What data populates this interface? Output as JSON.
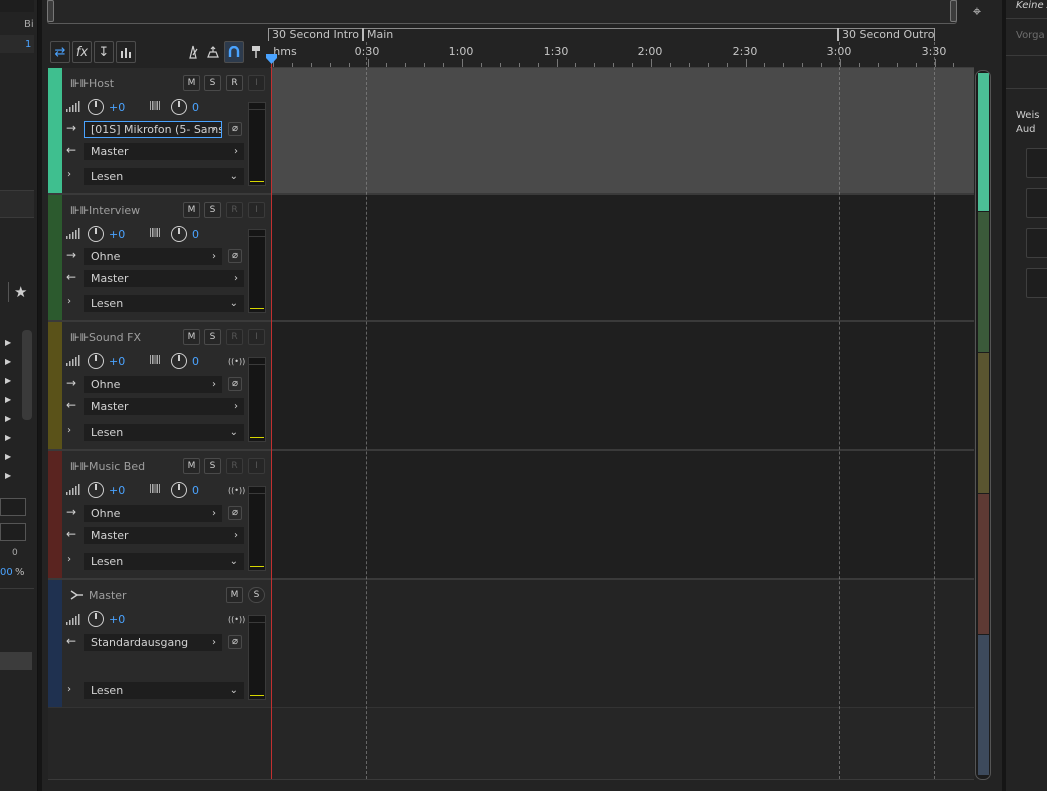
{
  "left_panel": {
    "bit_label": "Bi",
    "blue_value": "1",
    "zero_value": "0",
    "percent_value": "00",
    "percent_unit": "%"
  },
  "toolbar": {
    "buttons": [
      "toggle-inputs",
      "fx",
      "send",
      "eq",
      "metronome",
      "record-monitor",
      "snap",
      "marker"
    ]
  },
  "markers": [
    {
      "label": "30 Second Intro"
    },
    {
      "label": "Main"
    },
    {
      "label": "30 Second Outro"
    }
  ],
  "ruler": {
    "unit_label": "hms",
    "ticks": [
      "0:30",
      "1:00",
      "1:30",
      "2:00",
      "2:30",
      "3:00",
      "3:30"
    ]
  },
  "tracks": [
    {
      "name": "Host",
      "color": "#3fbf8f",
      "volume": "+0",
      "pan": "0",
      "input": "[01S] Mikrofon (5- Sams",
      "output": "Master",
      "automation": "Lesen",
      "input_focused": true
    },
    {
      "name": "Interview",
      "color": "#2c5a2e",
      "volume": "+0",
      "pan": "0",
      "input": "Ohne",
      "output": "Master",
      "automation": "Lesen",
      "input_focused": false
    },
    {
      "name": "Sound FX",
      "color": "#5a5219",
      "volume": "+0",
      "pan": "0",
      "input": "Ohne",
      "output": "Master",
      "automation": "Lesen",
      "input_focused": false
    },
    {
      "name": "Music Bed",
      "color": "#5a2420",
      "volume": "+0",
      "pan": "0",
      "input": "Ohne",
      "output": "Master",
      "automation": "Lesen",
      "input_focused": false
    }
  ],
  "master": {
    "name": "Master",
    "color": "#1f3150",
    "volume": "+0",
    "output": "Standardausgang",
    "automation": "Lesen"
  },
  "track_buttons": {
    "mute": "M",
    "solo": "S",
    "record": "R",
    "input": "I"
  },
  "right_panel": {
    "header_text": "Keine A",
    "preset_text": "Vorga",
    "line1": "Weis",
    "line2": "Aud"
  }
}
